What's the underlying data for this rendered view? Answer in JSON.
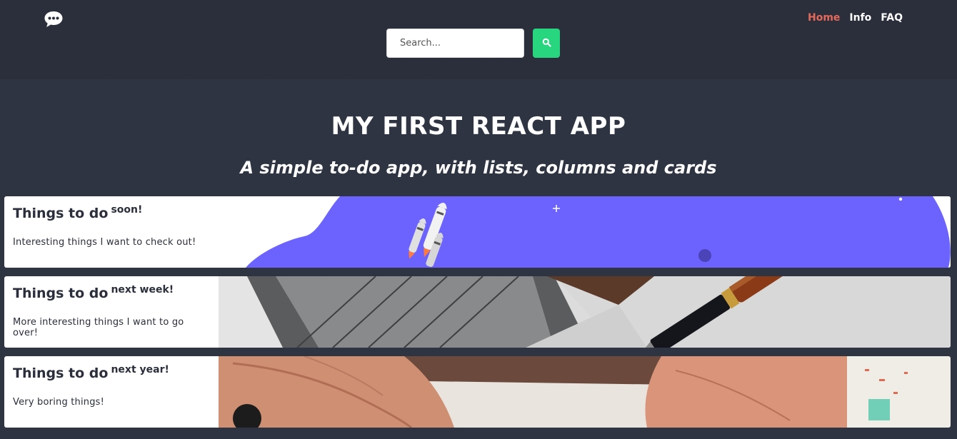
{
  "nav": {
    "logo_icon": "chat-bubble-icon",
    "links": [
      {
        "label": "Home",
        "active": true
      },
      {
        "label": "Info",
        "active": false
      },
      {
        "label": "FAQ",
        "active": false
      }
    ],
    "search": {
      "placeholder": "Search...",
      "value": "",
      "button_icon": "search-icon"
    }
  },
  "hero": {
    "title": "MY FIRST REACT APP",
    "subtitle": "A simple to-do app, with lists, columns and cards"
  },
  "lists": [
    {
      "title": "Things to do",
      "sup": "soon!",
      "description": "Interesting things I want to check out!",
      "image": "rocket-illustration"
    },
    {
      "title": "Things to do",
      "sup": "next week!",
      "description": "More interesting things I want to go over!",
      "image": "pen-paper-photo"
    },
    {
      "title": "Things to do",
      "sup": "next year!",
      "description": "Very boring things!",
      "image": "hands-writing-photo"
    }
  ],
  "colors": {
    "nav_bg": "#2a2f3b",
    "page_bg": "#2f3443",
    "active_link": "#e5685a",
    "search_button": "#27d67f",
    "rocket_bg": "#6c63ff"
  }
}
